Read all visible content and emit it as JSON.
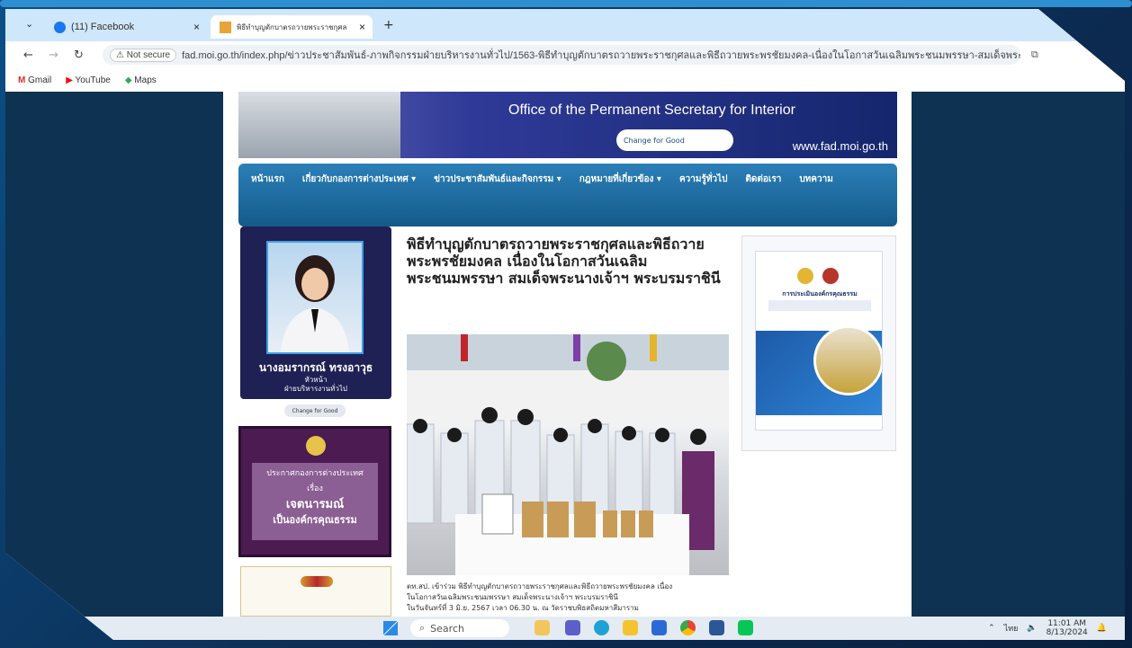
{
  "tabs": [
    {
      "label": "(11) Facebook",
      "close": "×",
      "icon": "facebook-icon"
    },
    {
      "label": "พิธีทำบุญตักบาตรถวายพระราชกุศล",
      "close": "×",
      "icon": "site-icon"
    }
  ],
  "new_tab": "+",
  "addressbar": {
    "security": "Not secure",
    "url": "fad.moi.go.th/index.php/ข่าวประชาสัมพันธ์-ภาพกิจกรรมฝ่ายบริหารงานทั่วไป/1563-พิธีทำบุญตักบาตรถวายพระราชกุศลและพิธีถวายพระพรชัยมงคล-เนื่องในโอกาสวันเฉลิมพระชนมพรรษา-สมเด็จพระนางเจ้าฯ-พระบรมราชินี"
  },
  "bookmarks": [
    "Gmail",
    "YouTube",
    "Maps"
  ],
  "banner": {
    "title": "Office of the Permanent Secretary for Interior",
    "url": "www.fad.moi.go.th",
    "badge": "Change for Good"
  },
  "nav": [
    "หน้าแรก",
    "เกี่ยวกับกองการต่างประเทศ ▾",
    "ข่าวประชาสัมพันธ์และกิจกรรม ▾",
    "กฎหมายที่เกี่ยวข้อง ▾",
    "ความรู้ทั่วไป",
    "ติดต่อเรา",
    "บทความ"
  ],
  "profile": {
    "name": "นางอมรากรณ์ ทรงอาวุธ",
    "role": "หัวหน้า",
    "dept": "ฝ่ายบริหารงานทั่วไป"
  },
  "change_badge": "Change for Good",
  "ad1": {
    "line1": "ประกาศกองการต่างประเทศ",
    "line2": "เรื่อง",
    "line3": "เจตนารมณ์",
    "line4": "เป็นองค์กรคุณธรรม"
  },
  "article": {
    "title": "พิธีทำบุญตักบาตรถวายพระราชกุศลและพิธีถวายพระพรชัยมงคล เนื่องในโอกาสวันเฉลิมพระชนมพรรษา สมเด็จพระนางเจ้าฯ พระบรมราชินี",
    "caption1": "ตท.สป. เข้าร่วม พิธีทำบุญตักบาตรถวายพระราชกุศลและพิธีถวายพระพรชัยมงคล เนื่อง",
    "caption2": "ในโอกาสวันเฉลิมพระชนมพรรษา สมเด็จพระนางเจ้าฯ พระบรมราชินี",
    "caption3": "ในวันจันทร์ที่ 3 มิ.ย. 2567 เวลา 06.30 น. ณ วัดราชบพิธสถิตมหาสีมาราม"
  },
  "poster_heading": "การประเมินองค์กรคุณธรรม",
  "taskbar": {
    "search": "Search",
    "time": "11:01 AM",
    "date": "8/13/2024",
    "lang": "ไทย"
  },
  "colors": {
    "accent": "#1a73e8",
    "nav": "#1d6fa6",
    "bg": "#0d3252"
  }
}
